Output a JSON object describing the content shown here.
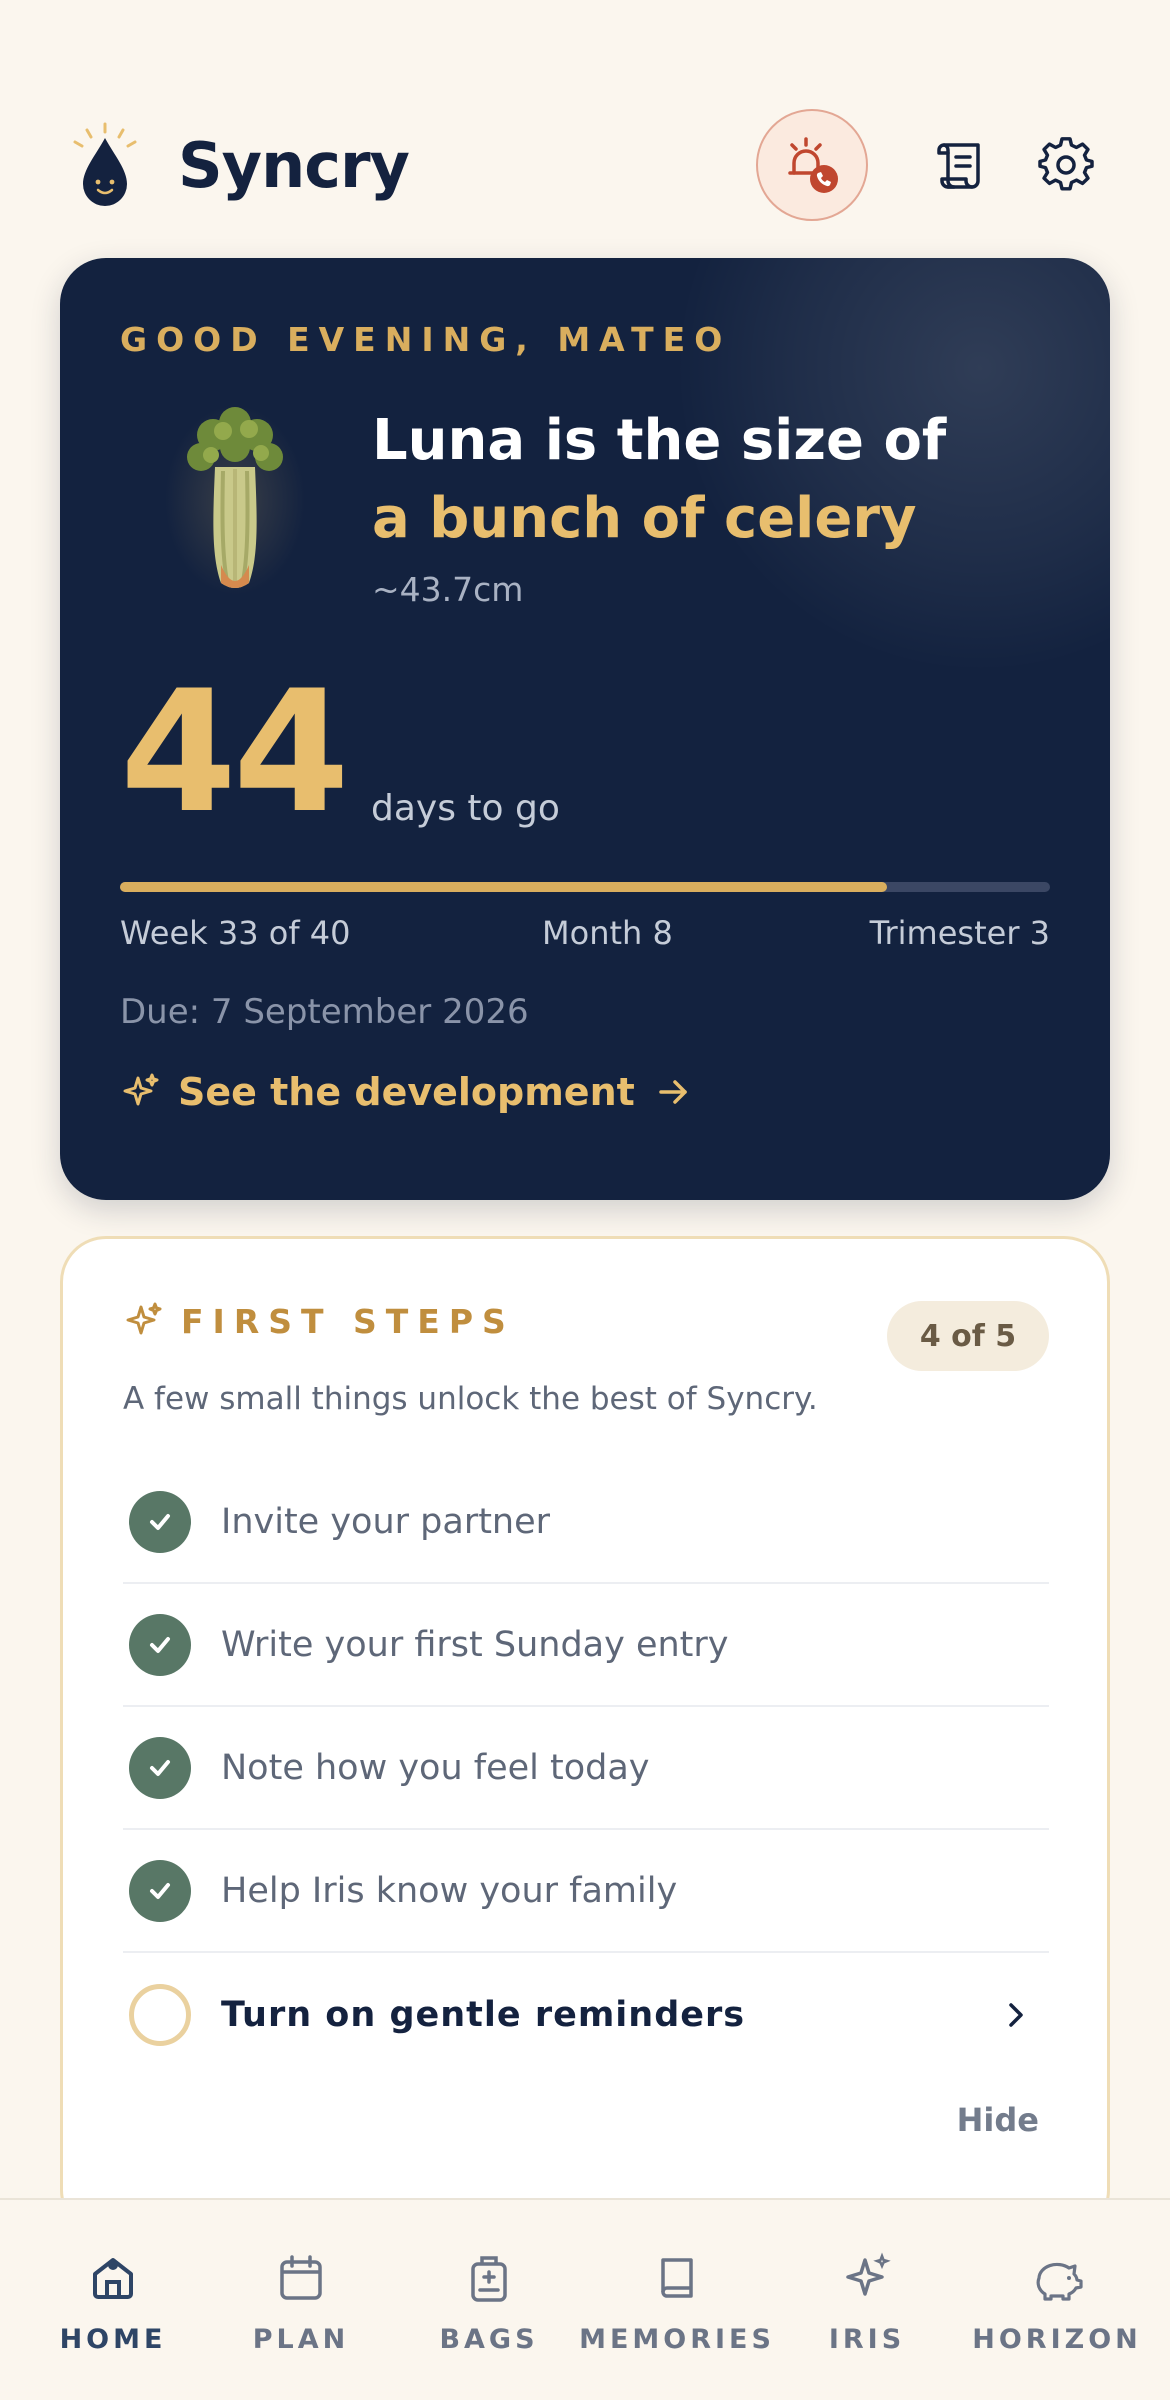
{
  "app": {
    "title": "Syncry"
  },
  "header": {
    "icons": [
      "logo-drop-icon",
      "emergency-call-icon",
      "scroll-icon",
      "gear-icon"
    ]
  },
  "hero": {
    "greeting": "GOOD EVENING, MATEO",
    "size_line1": "Luna is the size of",
    "size_line2": "a bunch of celery",
    "measurement": "~43.7cm",
    "days_number": "44",
    "days_label": "days to go",
    "progress_fraction": 0.825,
    "week": "Week 33 of 40",
    "month": "Month 8",
    "trimester": "Trimester 3",
    "due": "Due: 7 September 2026",
    "cta": "See the development"
  },
  "first_steps": {
    "title": "FIRST STEPS",
    "count": "4 of 5",
    "subtitle": "A few small things unlock the best of Syncry.",
    "items": [
      {
        "label": "Invite your partner",
        "done": true
      },
      {
        "label": "Write your first Sunday entry",
        "done": true
      },
      {
        "label": "Note how you feel today",
        "done": true
      },
      {
        "label": "Help Iris know your family",
        "done": true
      },
      {
        "label": "Turn on gentle reminders",
        "done": false
      }
    ],
    "hide_label": "Hide"
  },
  "nav": {
    "active": "HOME",
    "items": [
      {
        "label": "HOME",
        "icon": "home-icon"
      },
      {
        "label": "PLAN",
        "icon": "calendar-icon"
      },
      {
        "label": "BAGS",
        "icon": "bag-icon"
      },
      {
        "label": "MEMORIES",
        "icon": "book-icon"
      },
      {
        "label": "IRIS",
        "icon": "sparkle-icon"
      },
      {
        "label": "HORIZON",
        "icon": "piggy-bank-icon"
      }
    ]
  },
  "colors": {
    "background": "#FBF6EE",
    "navy": "#13223F",
    "gold": "#E8BE6E",
    "check_green": "#587766",
    "emergency": "#C0472F"
  }
}
